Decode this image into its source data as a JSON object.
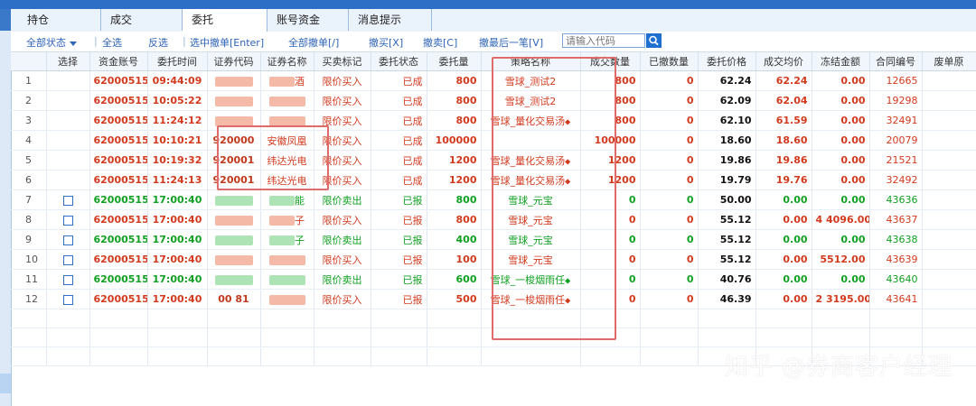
{
  "tabs": [
    {
      "label": "持仓",
      "active": false
    },
    {
      "label": "成交",
      "active": false
    },
    {
      "label": "委托",
      "active": true
    },
    {
      "label": "账号资金",
      "active": false
    },
    {
      "label": "消息提示",
      "active": false
    }
  ],
  "toolbar": {
    "status_filter": "全部状态",
    "select_all": "全选",
    "invert_select": "反选",
    "separator": "|",
    "cancel_selected": "选中撤单[Enter]",
    "cancel_all": "全部撤单[/]",
    "cancel_buy": "撤买[X]",
    "cancel_sell": "撤卖[C]",
    "cancel_last": "撤最后一笔[V]",
    "search_placeholder": "请输入代码"
  },
  "columns": [
    "",
    "选择",
    "资金账号",
    "委托时间",
    "证券代码",
    "证券名称",
    "买卖标记",
    "委托状态",
    "委托量",
    "策略名称",
    "成交数量",
    "已撤数量",
    "委托价格",
    "成交均价",
    "冻结金额",
    "合同编号",
    "废单原"
  ],
  "rows": [
    {
      "idx": "1",
      "checkbox": false,
      "account": "62000515",
      "time": "09:44:09",
      "code": "",
      "name": "酒",
      "side": "限价买入",
      "status": "已成",
      "qty": "800",
      "strategy": "雪球_测试2",
      "strategy_icon": false,
      "filled": "800",
      "canceled": "0",
      "price": "62.24",
      "avg": "62.24",
      "frozen": "0.00",
      "contract": "12665",
      "color": "red"
    },
    {
      "idx": "2",
      "checkbox": false,
      "account": "62000515",
      "time": "10:05:22",
      "code": "",
      "name": "",
      "side": "限价买入",
      "status": "已成",
      "qty": "800",
      "strategy": "雪球_测试2",
      "strategy_icon": false,
      "filled": "800",
      "canceled": "0",
      "price": "62.09",
      "avg": "62.04",
      "frozen": "0.00",
      "contract": "19298",
      "color": "red"
    },
    {
      "idx": "3",
      "checkbox": false,
      "account": "62000515",
      "time": "11:24:12",
      "code": "",
      "name": "",
      "side": "限价买入",
      "status": "已成",
      "qty": "800",
      "strategy": "雪球_量化交易汤",
      "strategy_icon": true,
      "filled": "800",
      "canceled": "0",
      "price": "62.10",
      "avg": "61.59",
      "frozen": "0.00",
      "contract": "32491",
      "color": "red"
    },
    {
      "idx": "4",
      "checkbox": false,
      "account": "62000515",
      "time": "10:10:21",
      "code": "920000",
      "name": "安徽凤凰",
      "side": "限价买入",
      "status": "已成",
      "qty": "100000",
      "strategy": "",
      "strategy_icon": false,
      "filled": "100000",
      "canceled": "0",
      "price": "18.60",
      "avg": "18.60",
      "frozen": "0.00",
      "contract": "20079",
      "color": "red"
    },
    {
      "idx": "5",
      "checkbox": false,
      "account": "62000515",
      "time": "10:19:32",
      "code": "920001",
      "name": "纬达光电",
      "side": "限价买入",
      "status": "已成",
      "qty": "1200",
      "strategy": "雪球_量化交易汤",
      "strategy_icon": true,
      "filled": "1200",
      "canceled": "0",
      "price": "19.86",
      "avg": "19.86",
      "frozen": "0.00",
      "contract": "21521",
      "color": "red"
    },
    {
      "idx": "6",
      "checkbox": false,
      "account": "62000515",
      "time": "11:24:13",
      "code": "920001",
      "name": "纬达光电",
      "side": "限价买入",
      "status": "已成",
      "qty": "1200",
      "strategy": "雪球_量化交易汤",
      "strategy_icon": true,
      "filled": "1200",
      "canceled": "0",
      "price": "19.79",
      "avg": "19.76",
      "frozen": "0.00",
      "contract": "32492",
      "color": "red"
    },
    {
      "idx": "7",
      "checkbox": true,
      "account": "62000515",
      "time": "17:00:40",
      "code": "",
      "name": "能",
      "side": "限价卖出",
      "status": "已报",
      "qty": "800",
      "strategy": "雪球_元宝",
      "strategy_icon": false,
      "filled": "0",
      "canceled": "0",
      "price": "50.00",
      "avg": "0.00",
      "frozen": "0.00",
      "contract": "43636",
      "color": "green"
    },
    {
      "idx": "8",
      "checkbox": true,
      "account": "62000515",
      "time": "17:00:40",
      "code": "",
      "name": "子",
      "side": "限价买入",
      "status": "已报",
      "qty": "800",
      "strategy": "雪球_元宝",
      "strategy_icon": false,
      "filled": "0",
      "canceled": "0",
      "price": "55.12",
      "avg": "0.00",
      "frozen": "4 4096.00",
      "contract": "43637",
      "color": "red"
    },
    {
      "idx": "9",
      "checkbox": true,
      "account": "62000515",
      "time": "17:00:40",
      "code": "",
      "name": "子",
      "side": "限价卖出",
      "status": "已报",
      "qty": "400",
      "strategy": "雪球_元宝",
      "strategy_icon": false,
      "filled": "0",
      "canceled": "0",
      "price": "55.12",
      "avg": "0.00",
      "frozen": "0.00",
      "contract": "43638",
      "color": "green"
    },
    {
      "idx": "10",
      "checkbox": true,
      "account": "62000515",
      "time": "17:00:40",
      "code": "",
      "name": "",
      "side": "限价买入",
      "status": "已报",
      "qty": "100",
      "strategy": "雪球_元宝",
      "strategy_icon": false,
      "filled": "0",
      "canceled": "0",
      "price": "55.12",
      "avg": "0.00",
      "frozen": "5512.00",
      "contract": "43639",
      "color": "red"
    },
    {
      "idx": "11",
      "checkbox": true,
      "account": "62000515",
      "time": "17:00:40",
      "code": "",
      "name": "",
      "side": "限价卖出",
      "status": "已报",
      "qty": "600",
      "strategy": "雪球_一梭烟雨任",
      "strategy_icon": true,
      "filled": "0",
      "canceled": "0",
      "price": "40.76",
      "avg": "0.00",
      "frozen": "0.00",
      "contract": "43640",
      "color": "green"
    },
    {
      "idx": "12",
      "checkbox": true,
      "account": "62000515",
      "time": "17:00:40",
      "code": "00 81",
      "name": "",
      "side": "限价买入",
      "status": "已报",
      "qty": "500",
      "strategy": "雪球_一梭烟雨任",
      "strategy_icon": true,
      "filled": "0",
      "canceled": "0",
      "price": "46.39",
      "avg": "0.00",
      "frozen": "2 3195.00",
      "contract": "43641",
      "color": "red"
    }
  ],
  "watermark": "知乎 @券商客户经理",
  "colors": {
    "buy": "#d23a1e",
    "sell": "#10a022",
    "accent": "#2e64b8",
    "highlight_box": "#e06b6b"
  }
}
